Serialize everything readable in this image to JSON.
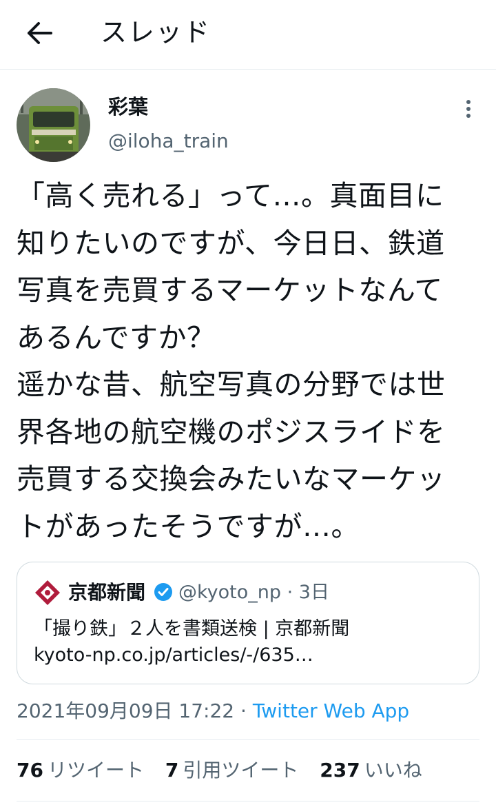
{
  "header": {
    "title": "スレッド"
  },
  "author": {
    "name": "彩葉",
    "handle": "@iloha_train"
  },
  "tweet": {
    "lines": [
      "「高く売れる」って…。真面目に",
      "知りたいのですが、今日日、鉄道",
      "写真を売買するマーケットなんて",
      "あるんですか？",
      "遥かな昔、航空写真の分野では世",
      "界各地の航空機のポジスライドを",
      "売買する交換会みたいなマーケッ",
      "トがあったそうですが…。"
    ]
  },
  "quote": {
    "name": "京都新聞",
    "handle": "@kyoto_np",
    "age": "3日",
    "text": "「撮り鉄」２人を書類送検 | 京都新聞",
    "link": "kyoto-np.co.jp/articles/-/635…"
  },
  "meta": {
    "timestamp": "2021年09月09日 17:22",
    "separator": " · ",
    "source": "Twitter Web App"
  },
  "stats": {
    "retweets": "76",
    "retweets_label": "リツイート",
    "quotes": "7",
    "quotes_label": "引用ツイート",
    "likes": "237",
    "likes_label": "いいね"
  },
  "colors": {
    "link": "#1d9bf0",
    "secondary": "#536471",
    "verified": "#1d9bf0",
    "logo": "#b01c3c"
  },
  "icons": {
    "back": "arrow-left-icon",
    "more": "more-vertical-icon",
    "verified": "verified-badge-icon",
    "logo": "kyoto-np-logo"
  }
}
